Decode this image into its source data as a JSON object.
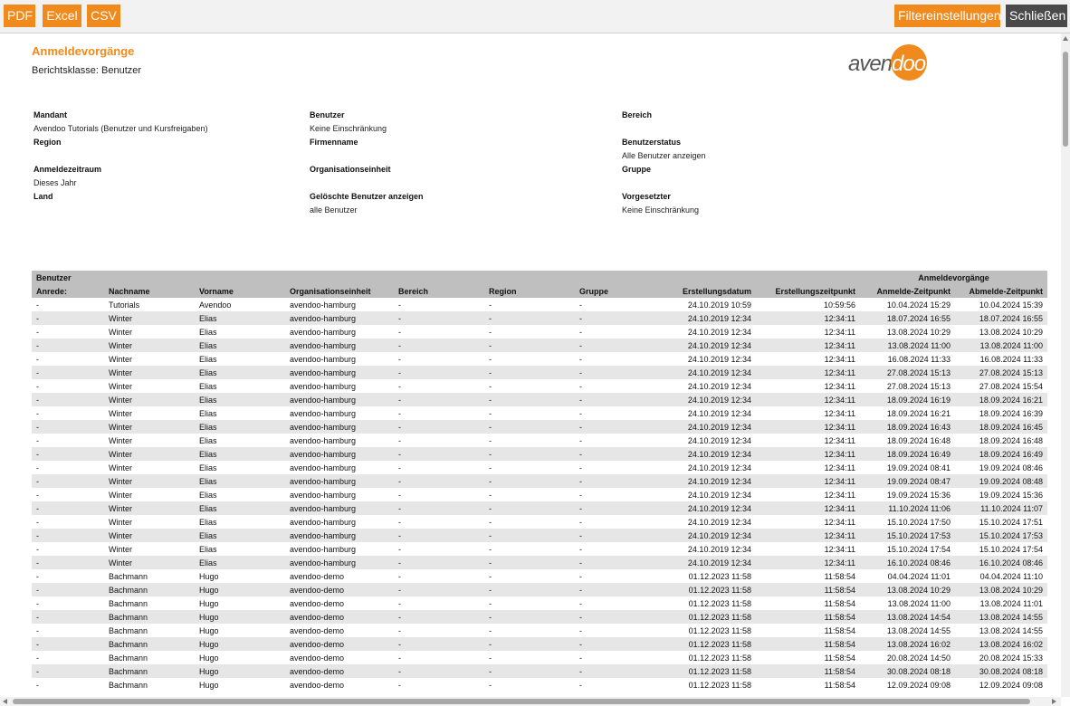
{
  "toolbar": {
    "pdf": "PDF",
    "excel": "Excel",
    "csv": "CSV",
    "filter": "Filtereinstellungen",
    "close": "Schließen"
  },
  "colors": {
    "accent": "#f08a1c",
    "dark_button": "#4a4a4a",
    "header_bg": "#bfbfbf",
    "alt_row": "#e6e6e6"
  },
  "report": {
    "title": "Anmeldevorgänge",
    "class_label": "Berichtsklasse: Benutzer"
  },
  "logo": {
    "part1": "aven",
    "part2": "doo"
  },
  "filters": {
    "mandant": {
      "label": "Mandant",
      "value": "Avendoo Tutorials (Benutzer und Kursfreigaben)"
    },
    "region": {
      "label": "Region",
      "value": ""
    },
    "anmeldezeitraum": {
      "label": "Anmeldezeitraum",
      "value": "Dieses Jahr"
    },
    "land": {
      "label": "Land",
      "value": ""
    },
    "benutzer": {
      "label": "Benutzer",
      "value": "Keine Einschränkung"
    },
    "firmenname": {
      "label": "Firmenname",
      "value": ""
    },
    "organisationseinheit": {
      "label": "Organisationseinheit",
      "value": ""
    },
    "geloeschte": {
      "label": "Gelöschte Benutzer anzeigen",
      "value": "alle Benutzer"
    },
    "bereich": {
      "label": "Bereich",
      "value": ""
    },
    "benutzerstatus": {
      "label": "Benutzerstatus",
      "value": "Alle Benutzer anzeigen"
    },
    "gruppe": {
      "label": "Gruppe",
      "value": ""
    },
    "vorgesetzter": {
      "label": "Vorgesetzter",
      "value": "Keine Einschränkung"
    }
  },
  "table": {
    "group_benutzer": "Benutzer",
    "group_anmeldevorgaenge": "Anmeldevorgänge",
    "columns": [
      "Anrede:",
      "Nachname",
      "Vorname",
      "Organisationseinheit",
      "Bereich",
      "Region",
      "Gruppe",
      "Erstellungsdatum",
      "Erstellungszeitpunkt",
      "Anmelde-Zeitpunkt",
      "Abmelde-Zeitpunkt"
    ],
    "rows": [
      [
        "-",
        "Tutorials",
        "Avendoo",
        "avendoo-hamburg",
        "-",
        "-",
        "-",
        "24.10.2019 10:59",
        "10:59:56",
        "10.04.2024 15:29",
        "10.04.2024 15:39"
      ],
      [
        "-",
        "Winter",
        "Elias",
        "avendoo-hamburg",
        "-",
        "-",
        "-",
        "24.10.2019 12:34",
        "12:34:11",
        "18.07.2024 16:55",
        "18.07.2024 16:55"
      ],
      [
        "-",
        "Winter",
        "Elias",
        "avendoo-hamburg",
        "-",
        "-",
        "-",
        "24.10.2019 12:34",
        "12:34:11",
        "13.08.2024 10:29",
        "13.08.2024 10:29"
      ],
      [
        "-",
        "Winter",
        "Elias",
        "avendoo-hamburg",
        "-",
        "-",
        "-",
        "24.10.2019 12:34",
        "12:34:11",
        "13.08.2024 11:00",
        "13.08.2024 11:00"
      ],
      [
        "-",
        "Winter",
        "Elias",
        "avendoo-hamburg",
        "-",
        "-",
        "-",
        "24.10.2019 12:34",
        "12:34:11",
        "16.08.2024 11:33",
        "16.08.2024 11:33"
      ],
      [
        "-",
        "Winter",
        "Elias",
        "avendoo-hamburg",
        "-",
        "-",
        "-",
        "24.10.2019 12:34",
        "12:34:11",
        "27.08.2024 15:13",
        "27.08.2024 15:13"
      ],
      [
        "-",
        "Winter",
        "Elias",
        "avendoo-hamburg",
        "-",
        "-",
        "-",
        "24.10.2019 12:34",
        "12:34:11",
        "27.08.2024 15:13",
        "27.08.2024 15:54"
      ],
      [
        "-",
        "Winter",
        "Elias",
        "avendoo-hamburg",
        "-",
        "-",
        "-",
        "24.10.2019 12:34",
        "12:34:11",
        "18.09.2024 16:19",
        "18.09.2024 16:21"
      ],
      [
        "-",
        "Winter",
        "Elias",
        "avendoo-hamburg",
        "-",
        "-",
        "-",
        "24.10.2019 12:34",
        "12:34:11",
        "18.09.2024 16:21",
        "18.09.2024 16:39"
      ],
      [
        "-",
        "Winter",
        "Elias",
        "avendoo-hamburg",
        "-",
        "-",
        "-",
        "24.10.2019 12:34",
        "12:34:11",
        "18.09.2024 16:43",
        "18.09.2024 16:45"
      ],
      [
        "-",
        "Winter",
        "Elias",
        "avendoo-hamburg",
        "-",
        "-",
        "-",
        "24.10.2019 12:34",
        "12:34:11",
        "18.09.2024 16:48",
        "18.09.2024 16:48"
      ],
      [
        "-",
        "Winter",
        "Elias",
        "avendoo-hamburg",
        "-",
        "-",
        "-",
        "24.10.2019 12:34",
        "12:34:11",
        "18.09.2024 16:49",
        "18.09.2024 16:49"
      ],
      [
        "-",
        "Winter",
        "Elias",
        "avendoo-hamburg",
        "-",
        "-",
        "-",
        "24.10.2019 12:34",
        "12:34:11",
        "19.09.2024 08:41",
        "19.09.2024 08:46"
      ],
      [
        "-",
        "Winter",
        "Elias",
        "avendoo-hamburg",
        "-",
        "-",
        "-",
        "24.10.2019 12:34",
        "12:34:11",
        "19.09.2024 08:47",
        "19.09.2024 08:48"
      ],
      [
        "-",
        "Winter",
        "Elias",
        "avendoo-hamburg",
        "-",
        "-",
        "-",
        "24.10.2019 12:34",
        "12:34:11",
        "19.09.2024 15:36",
        "19.09.2024 15:36"
      ],
      [
        "-",
        "Winter",
        "Elias",
        "avendoo-hamburg",
        "-",
        "-",
        "-",
        "24.10.2019 12:34",
        "12:34:11",
        "11.10.2024 11:06",
        "11.10.2024 11:07"
      ],
      [
        "-",
        "Winter",
        "Elias",
        "avendoo-hamburg",
        "-",
        "-",
        "-",
        "24.10.2019 12:34",
        "12:34:11",
        "15.10.2024 17:50",
        "15.10.2024 17:51"
      ],
      [
        "-",
        "Winter",
        "Elias",
        "avendoo-hamburg",
        "-",
        "-",
        "-",
        "24.10.2019 12:34",
        "12:34:11",
        "15.10.2024 17:53",
        "15.10.2024 17:53"
      ],
      [
        "-",
        "Winter",
        "Elias",
        "avendoo-hamburg",
        "-",
        "-",
        "-",
        "24.10.2019 12:34",
        "12:34:11",
        "15.10.2024 17:54",
        "15.10.2024 17:54"
      ],
      [
        "-",
        "Winter",
        "Elias",
        "avendoo-hamburg",
        "-",
        "-",
        "-",
        "24.10.2019 12:34",
        "12:34:11",
        "16.10.2024 08:46",
        "16.10.2024 08:46"
      ],
      [
        "-",
        "Bachmann",
        "Hugo",
        "avendoo-demo",
        "-",
        "-",
        "-",
        "01.12.2023 11:58",
        "11:58:54",
        "04.04.2024 11:01",
        "04.04.2024 11:10"
      ],
      [
        "-",
        "Bachmann",
        "Hugo",
        "avendoo-demo",
        "-",
        "-",
        "-",
        "01.12.2023 11:58",
        "11:58:54",
        "13.08.2024 10:29",
        "13.08.2024 10:29"
      ],
      [
        "-",
        "Bachmann",
        "Hugo",
        "avendoo-demo",
        "-",
        "-",
        "-",
        "01.12.2023 11:58",
        "11:58:54",
        "13.08.2024 11:00",
        "13.08.2024 11:01"
      ],
      [
        "-",
        "Bachmann",
        "Hugo",
        "avendoo-demo",
        "-",
        "-",
        "-",
        "01.12.2023 11:58",
        "11:58:54",
        "13.08.2024 14:54",
        "13.08.2024 14:55"
      ],
      [
        "-",
        "Bachmann",
        "Hugo",
        "avendoo-demo",
        "-",
        "-",
        "-",
        "01.12.2023 11:58",
        "11:58:54",
        "13.08.2024 14:55",
        "13.08.2024 14:55"
      ],
      [
        "-",
        "Bachmann",
        "Hugo",
        "avendoo-demo",
        "-",
        "-",
        "-",
        "01.12.2023 11:58",
        "11:58:54",
        "13.08.2024 16:02",
        "13.08.2024 16:02"
      ],
      [
        "-",
        "Bachmann",
        "Hugo",
        "avendoo-demo",
        "-",
        "-",
        "-",
        "01.12.2023 11:58",
        "11:58:54",
        "20.08.2024 14:50",
        "20.08.2024 15:33"
      ],
      [
        "-",
        "Bachmann",
        "Hugo",
        "avendoo-demo",
        "-",
        "-",
        "-",
        "01.12.2023 11:58",
        "11:58:54",
        "30.08.2024 08:18",
        "30.08.2024 08:18"
      ],
      [
        "-",
        "Bachmann",
        "Hugo",
        "avendoo-demo",
        "-",
        "-",
        "-",
        "01.12.2023 11:58",
        "11:58:54",
        "12.09.2024 09:08",
        "12.09.2024 09:08"
      ]
    ]
  }
}
